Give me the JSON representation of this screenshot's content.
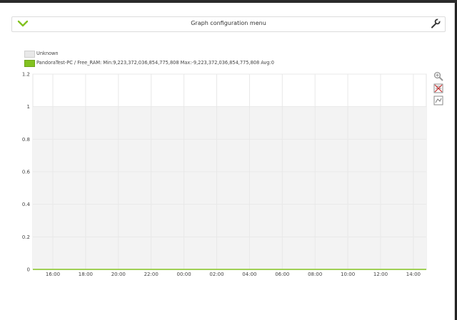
{
  "config_menu": {
    "title": "Graph configuration menu"
  },
  "legend": [
    {
      "label": "Unknown",
      "color": "#e8e8e8"
    },
    {
      "label": "PandoraTest-PC / Free_RAM: Min:9,223,372,036,854,775,808 Max:-9,223,372,036,854,775,808 Avg:0",
      "color": "#82c220"
    }
  ],
  "toolbar": {
    "zoom_icon": "zoom-icon",
    "hide_legend_icon": "legend-icon",
    "export_icon": "export-icon"
  },
  "colors": {
    "accent": "#82c220",
    "unknown_fill": "#f3f3f3",
    "grid": "#e8e8e8"
  },
  "chart_data": {
    "type": "area",
    "y_ticks": [
      0,
      0.2,
      0.4,
      0.6,
      0.8,
      1,
      1.2
    ],
    "y_tick_labels": [
      "0",
      "0.2",
      "0.4",
      "0.6",
      "0.8",
      "1",
      "1.2"
    ],
    "ylim": [
      0,
      1.2
    ],
    "x_ticks": [
      "16:00",
      "18:00",
      "20:00",
      "22:00",
      "00:00",
      "02:00",
      "04:00",
      "06:00",
      "08:00",
      "10:00",
      "12:00",
      "14:00"
    ],
    "series": [
      {
        "name": "Unknown",
        "values": [
          1,
          1,
          1,
          1,
          1,
          1,
          1,
          1,
          1,
          1,
          1,
          1
        ]
      },
      {
        "name": "PandoraTest-PC / Free_RAM",
        "values": [
          0,
          0,
          0,
          0,
          0,
          0,
          0,
          0,
          0,
          0,
          0,
          0
        ]
      }
    ],
    "grid": true
  }
}
